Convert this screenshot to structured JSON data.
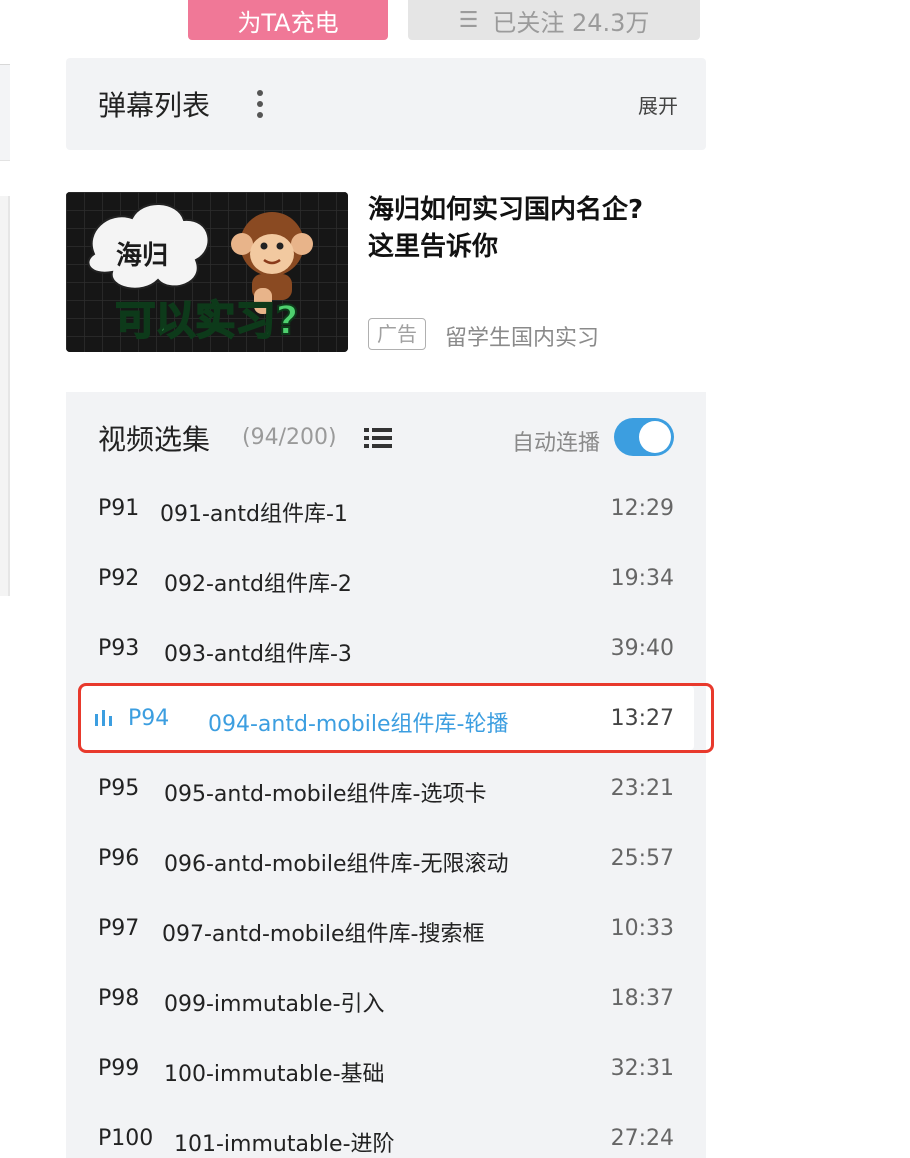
{
  "top_buttons": {
    "charge_label": "为TA充电",
    "follow_label": "已关注 24.3万",
    "follow_icon": "menu-icon",
    "charge_color": "#f07897"
  },
  "danmaku": {
    "title": "弹幕列表",
    "expand_label": "展开"
  },
  "ad": {
    "title_line1": "海归如何实习国内名企?",
    "title_line2": "这里告诉你",
    "tag": "广告",
    "source": "留学生国内实习",
    "image_bubble_text": "海归",
    "image_main_text": "可以实习?"
  },
  "playlist": {
    "title": "视频选集",
    "count": "(94/200)",
    "autoplay_label": "自动连播",
    "autoplay_on": true,
    "accent_color": "#3c9ee0",
    "episodes": [
      {
        "no": "P91",
        "name": "091-antd组件库-1",
        "duration": "12:29"
      },
      {
        "no": "P92",
        "name": "092-antd组件库-2",
        "duration": "19:34"
      },
      {
        "no": "P93",
        "name": "093-antd组件库-3",
        "duration": "39:40"
      },
      {
        "no": "P94",
        "name": "094-antd-mobile组件库-轮播",
        "duration": "13:27",
        "active": true
      },
      {
        "no": "P95",
        "name": "095-antd-mobile组件库-选项卡",
        "duration": "23:21"
      },
      {
        "no": "P96",
        "name": "096-antd-mobile组件库-无限滚动",
        "duration": "25:57"
      },
      {
        "no": "P97",
        "name": "097-antd-mobile组件库-搜索框",
        "duration": "10:33"
      },
      {
        "no": "P98",
        "name": "099-immutable-引入",
        "duration": "18:37"
      },
      {
        "no": "P99",
        "name": "100-immutable-基础",
        "duration": "32:31"
      },
      {
        "no": "P100",
        "name": "101-immutable-进阶",
        "duration": "27:24"
      }
    ]
  },
  "highlight_color": "#e8392c"
}
